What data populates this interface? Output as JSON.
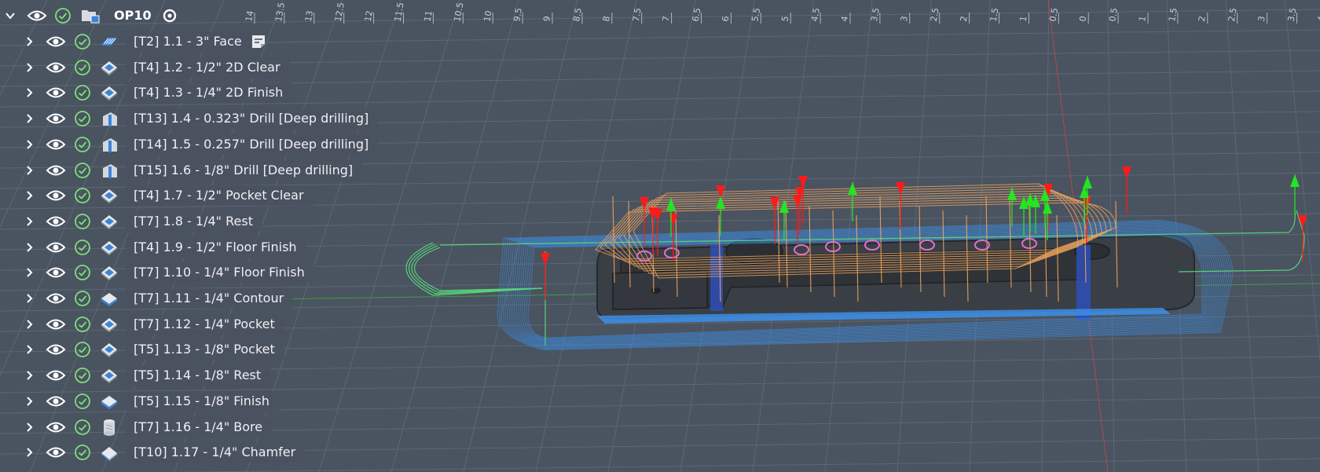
{
  "setup": {
    "label": "OP10",
    "toggle_icon": "chevron-down-icon",
    "visibility_icon": "eye-icon",
    "status_icon": "check-circle-icon",
    "setup_icon": "setup-folder-icon",
    "active_icon": "active-radio-icon"
  },
  "operations": [
    {
      "label": "[T2] 1.1 - 3\" Face",
      "icon": "face-icon",
      "has_note": true
    },
    {
      "label": "[T4] 1.2 - 1/2\" 2D Clear",
      "icon": "pocket-2d-icon",
      "has_note": false
    },
    {
      "label": "[T4] 1.3 - 1/4\" 2D Finish",
      "icon": "pocket-2d-icon",
      "has_note": false
    },
    {
      "label": "[T13] 1.4 - 0.323\" Drill [Deep drilling]",
      "icon": "drill-icon",
      "has_note": false
    },
    {
      "label": "[T14] 1.5 - 0.257\" Drill [Deep drilling]",
      "icon": "drill-icon",
      "has_note": false
    },
    {
      "label": "[T15] 1.6 - 1/8\" Drill [Deep drilling]",
      "icon": "drill-icon",
      "has_note": false
    },
    {
      "label": "[T4] 1.7 - 1/2\" Pocket Clear",
      "icon": "pocket-2d-icon",
      "has_note": false
    },
    {
      "label": "[T7] 1.8 - 1/4\" Rest",
      "icon": "pocket-2d-icon",
      "has_note": false
    },
    {
      "label": "[T4] 1.9 - 1/2\" Floor Finish",
      "icon": "pocket-2d-icon",
      "has_note": false
    },
    {
      "label": "[T7] 1.10 - 1/4\" Floor Finish",
      "icon": "pocket-2d-icon",
      "has_note": false
    },
    {
      "label": "[T7] 1.11 - 1/4\" Contour",
      "icon": "contour-icon",
      "has_note": false
    },
    {
      "label": "[T7] 1.12 - 1/4\" Pocket",
      "icon": "pocket-2d-icon",
      "has_note": false
    },
    {
      "label": "[T5] 1.13 - 1/8\" Pocket",
      "icon": "pocket-2d-icon",
      "has_note": false
    },
    {
      "label": "[T5] 1.14 - 1/8\" Rest",
      "icon": "pocket-2d-icon",
      "has_note": false
    },
    {
      "label": "[T5] 1.15 - 1/8\" Finish",
      "icon": "contour-icon",
      "has_note": false
    },
    {
      "label": "[T7] 1.16 - 1/4\" Bore",
      "icon": "bore-icon",
      "has_note": false
    },
    {
      "label": "[T10] 1.17 - 1/4\" Chamfer",
      "icon": "chamfer-icon",
      "has_note": false
    }
  ],
  "ruler": {
    "ticks": [
      "14",
      "13.5",
      "13",
      "12.5",
      "12",
      "11.5",
      "11",
      "10.5",
      "10",
      "9.5",
      "9",
      "8.5",
      "8",
      "7.5",
      "7",
      "6.5",
      "6",
      "5.5",
      "5",
      "4.5",
      "4",
      "3.5",
      "3",
      "2.5",
      "2",
      "1.5",
      "1",
      "0.5",
      "0",
      "0.5",
      "1",
      "1.5",
      "2",
      "2.5",
      "3",
      "3.5",
      "4"
    ]
  },
  "colors": {
    "background": "#4a5360",
    "grid": "#5d6774",
    "toolpath_rapid": "#f5a65b",
    "toolpath_cut": "#3d8fe8",
    "lead": "#57d27a",
    "plunge_arrow": "#ff1a1a",
    "retract_arrow": "#22e622",
    "label_bg": "#4a5360",
    "check_green": "#7fe07a"
  }
}
